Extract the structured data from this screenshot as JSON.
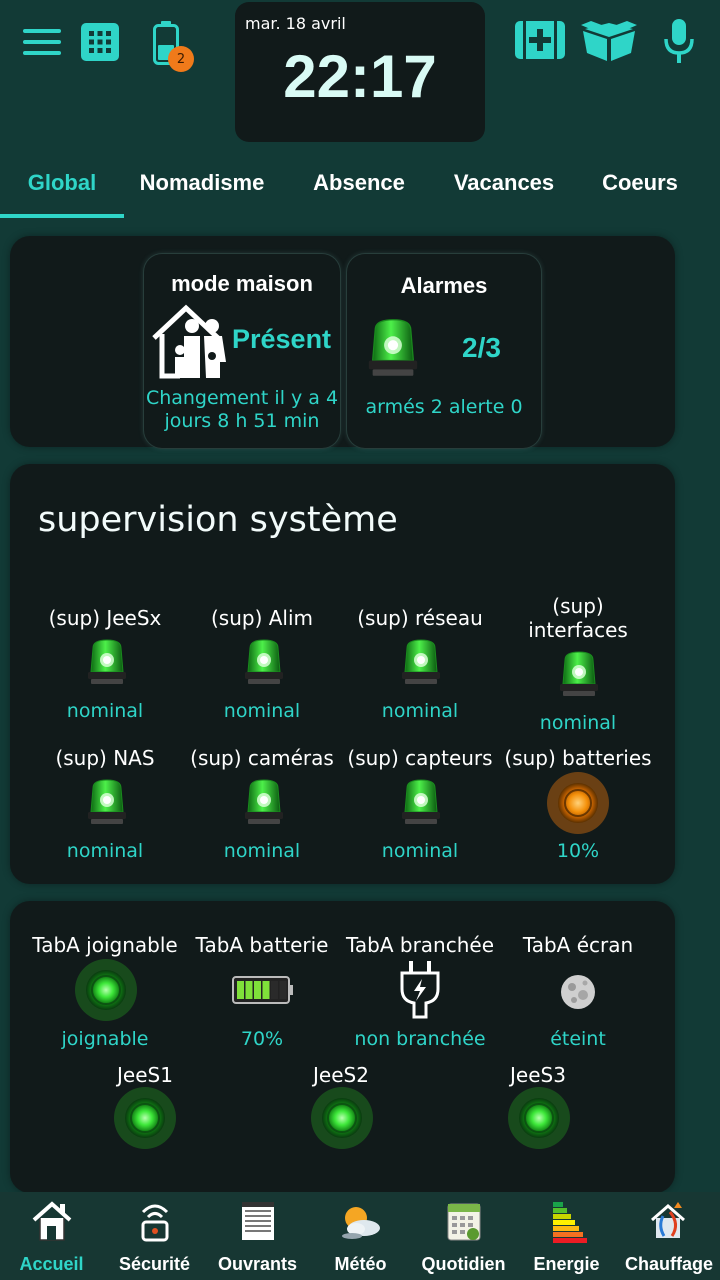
{
  "header": {
    "date": "mar. 18 avril",
    "time": "22:17",
    "battery_badge_count": "2",
    "accent_color": "#2fd5c8"
  },
  "tabs": [
    {
      "label": "Global",
      "active": true
    },
    {
      "label": "Nomadisme"
    },
    {
      "label": "Absence"
    },
    {
      "label": "Vacances"
    },
    {
      "label": "Coeurs"
    }
  ],
  "mode_maison": {
    "title": "mode maison",
    "value": "Présent",
    "change_line1": "Changement il y a 4",
    "change_line2": "jours 8 h 51 min"
  },
  "alarmes": {
    "title": "Alarmes",
    "value": "2/3",
    "detail": "armés 2 alerte 0"
  },
  "supervision": {
    "title": "supervision système",
    "items": [
      {
        "label": "(sup) JeeSx",
        "status": "nominal",
        "icon": "green-alarm-light-icon"
      },
      {
        "label": "(sup) Alim",
        "status": "nominal",
        "icon": "green-alarm-light-icon"
      },
      {
        "label": "(sup) réseau",
        "status": "nominal",
        "icon": "green-alarm-light-icon"
      },
      {
        "label_line1": "(sup)",
        "label_line2": "interfaces",
        "status": "nominal",
        "icon": "green-alarm-light-icon"
      },
      {
        "label": "(sup) NAS",
        "status": "nominal",
        "icon": "green-alarm-light-icon"
      },
      {
        "label": "(sup) caméras",
        "status": "nominal",
        "icon": "green-alarm-light-icon"
      },
      {
        "label": "(sup) capteurs",
        "status": "nominal",
        "icon": "green-alarm-light-icon"
      },
      {
        "label": "(sup) batteries",
        "status": "10%",
        "icon": "orange-indicator-icon"
      }
    ]
  },
  "tablet": {
    "items": [
      {
        "label": "TabA joignable",
        "status": "joignable",
        "icon": "green-led-icon"
      },
      {
        "label": "TabA batterie",
        "status": "70%",
        "icon": "battery-level-icon",
        "level": 0.7
      },
      {
        "label": "TabA branchée",
        "status": "non branchée",
        "icon": "plug-icon"
      },
      {
        "label": "TabA écran",
        "status": "éteint",
        "icon": "moon-icon"
      }
    ],
    "jees": [
      {
        "label": "JeeS1",
        "icon": "green-led-icon"
      },
      {
        "label": "JeeS2",
        "icon": "green-led-icon"
      },
      {
        "label": "JeeS3",
        "icon": "green-led-icon"
      }
    ]
  },
  "bottom_nav": [
    {
      "label": "Accueil",
      "icon": "home-icon",
      "active": true
    },
    {
      "label": "Sécurité",
      "icon": "security-icon"
    },
    {
      "label": "Ouvrants",
      "icon": "shutter-icon"
    },
    {
      "label": "Météo",
      "icon": "weather-icon"
    },
    {
      "label": "Quotidien",
      "icon": "calendar-icon"
    },
    {
      "label": "Energie",
      "icon": "energy-icon"
    },
    {
      "label": "Chauffage",
      "icon": "heating-icon"
    }
  ]
}
